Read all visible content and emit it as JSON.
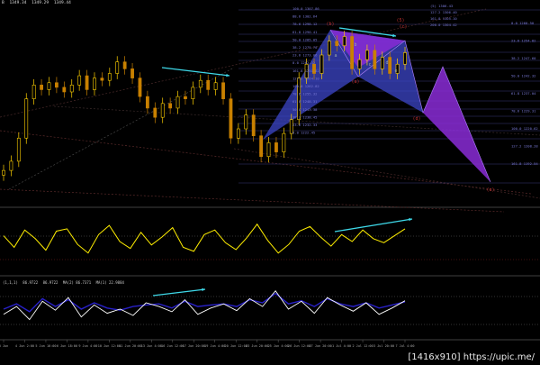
{
  "header": {
    "symbol": "B",
    "prices": [
      "1349.34",
      "1349.29",
      "1349.44"
    ]
  },
  "indicator1": {
    "label": ""
  },
  "indicator2": {
    "values": [
      "(1,1,1)",
      "86.9722",
      "86.9722",
      "MA(2) 86.7371",
      "MA(1) 22.9884"
    ]
  },
  "watermark": "[1416x910] https://upic.me/",
  "colors": {
    "background": "#000000",
    "bull_candle": "#ffd000",
    "bear_candle": "#c88000",
    "wave_arrow": "#3ed8e8",
    "pattern_blue": "#3c46c8",
    "pattern_purple": "#8a2bd6",
    "osc_line": "#ffee00",
    "stoch_main": "#ffffff",
    "stoch_signal": "#2820c8",
    "label_red": "#c03030",
    "fib_label": "#7a7ad8"
  },
  "fib_labels": [
    "100.0 1307.86",
    "88.6 1302.64",
    "78.6 1298.12",
    "61.8 1290.41",
    "50.0 1285.05",
    "38.2 1279.70",
    "23.6 1273.06",
    "0.0 1262.32",
    "161.8 1251.82",
    "127.2 1264.10",
    "100.0 1262.82",
    "78.6 1255.32",
    "61.8 1248.31",
    "50.0 1243.38",
    "38.2 1238.45",
    "23.6 1232.33",
    "0.0 1222.45"
  ],
  "right_labels": [
    "0.0 1260.50",
    "23.6 1254.82",
    "38.2 1247.60",
    "50.0 1242.32",
    "61.8 1237.04",
    "78.6 1229.31",
    "100.0 1220.62",
    "127.2 1208.28",
    "161.8 1192.54"
  ],
  "top_labels": [
    "(5) 1306.43",
    "127.2 1306.40",
    "161.8 1305.10",
    "200.0 1304.42"
  ],
  "wave_labels": [
    "(b)",
    "a",
    "b",
    "c",
    "d",
    "e",
    "(a)",
    "(c)",
    "(d)",
    "(e)",
    "(5)"
  ],
  "x_ticks": [
    "3 Jun",
    "4 Jun 2:00",
    "5 Jun 10:00",
    "6 Jun 18:00",
    "9 Jun 4:00",
    "10 Jun 12:00",
    "11 Jun 20:00",
    "13 Jun 4:00",
    "16 Jun 12:00",
    "17 Jun 20:00",
    "19 Jun 4:00",
    "20 Jun 12:00",
    "23 Jun 20:00",
    "25 Jun 4:00",
    "26 Jun 12:00",
    "27 Jun 20:00",
    "1 Jul 4:00",
    "2 Jul 12:00",
    "3 Jul 20:00",
    "7 Jul 4:00"
  ],
  "chart_data": {
    "type": "candlestick",
    "series": [
      {
        "name": "",
        "close": [
          1254,
          1258,
          1268,
          1285,
          1291,
          1289,
          1292,
          1290,
          1288,
          1291,
          1295,
          1289,
          1294,
          1293,
          1296,
          1301,
          1298,
          1294,
          1286,
          1281,
          1277,
          1283,
          1281,
          1286,
          1285,
          1290,
          1293,
          1289,
          1292,
          1285,
          1268,
          1272,
          1278,
          1269,
          1260,
          1266,
          1262,
          1270,
          1276,
          1294,
          1300,
          1296,
          1304,
          1310,
          1308,
          1312,
          1298,
          1302,
          1306,
          1298,
          1303,
          1296,
          1300,
          1305
        ]
      },
      {
        "name": "oscillator",
        "values": [
          60,
          40,
          70,
          55,
          35,
          68,
          72,
          45,
          30,
          62,
          78,
          50,
          38,
          66,
          44,
          58,
          74,
          40,
          33,
          62,
          70,
          48,
          36,
          56,
          80,
          52,
          30,
          45,
          68,
          76,
          58,
          42,
          62,
          50,
          70,
          55,
          48,
          60,
          72
        ]
      },
      {
        "name": "stochastic_main",
        "values": [
          40,
          55,
          30,
          65,
          48,
          72,
          35,
          58,
          42,
          50,
          38,
          62,
          55,
          45,
          68,
          40,
          52,
          60,
          47,
          70,
          55,
          85,
          50,
          65,
          42,
          72,
          58,
          46,
          62,
          40,
          52,
          66
        ]
      },
      {
        "name": "stochastic_signal",
        "values": [
          50,
          60,
          45,
          70,
          55,
          68,
          50,
          62,
          52,
          48,
          55,
          58,
          60,
          52,
          65,
          55,
          58,
          60,
          55,
          68,
          62,
          80,
          60,
          66,
          55,
          70,
          60,
          55,
          62,
          52,
          58,
          64
        ]
      }
    ],
    "x_ticks": [
      "3 Jun",
      "4 Jun 2:00",
      "5 Jun 10:00",
      "6 Jun 18:00",
      "9 Jun 4:00",
      "10 Jun 12:00",
      "11 Jun 20:00",
      "13 Jun 4:00",
      "16 Jun 12:00",
      "17 Jun 20:00",
      "19 Jun 4:00",
      "20 Jun 12:00",
      "23 Jun 20:00",
      "25 Jun 4:00",
      "26 Jun 12:00",
      "27 Jun 20:00",
      "1 Jul 4:00",
      "2 Jul 12:00",
      "3 Jul 20:00",
      "7 Jul 4:00"
    ],
    "grid": false
  }
}
